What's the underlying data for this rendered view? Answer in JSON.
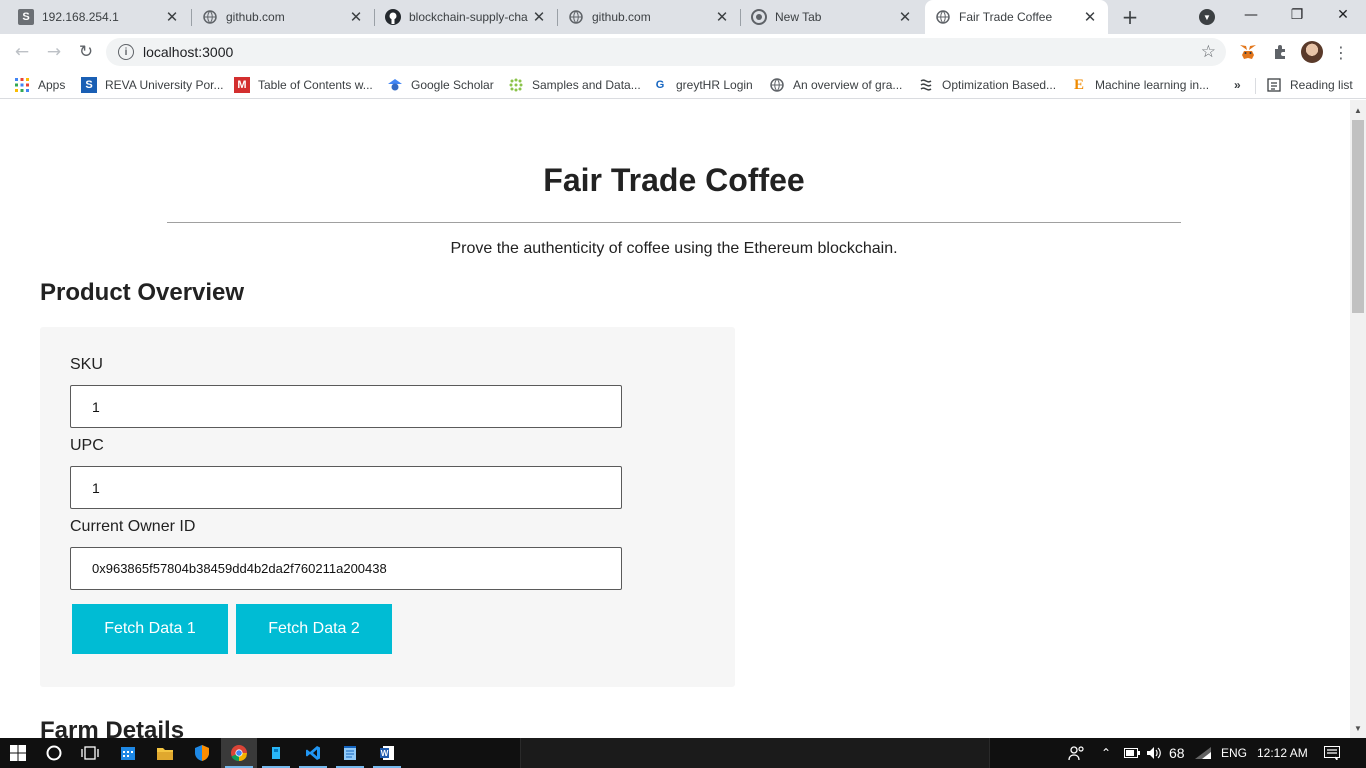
{
  "browser": {
    "tabs": [
      {
        "title": "192.168.254.1",
        "icon": "letter-s-icon"
      },
      {
        "title": "github.com",
        "icon": "globe-icon"
      },
      {
        "title": "blockchain-supply-cha",
        "icon": "github-icon"
      },
      {
        "title": "github.com",
        "icon": "globe-icon"
      },
      {
        "title": "New Tab",
        "icon": "chrome-icon"
      },
      {
        "title": "Fair Trade Coffee",
        "icon": "globe-icon",
        "active": true
      }
    ],
    "url": "localhost:3000",
    "bookmarks": [
      {
        "label": "Apps",
        "icon": "apps-grid-icon"
      },
      {
        "label": "REVA University Por...",
        "icon": "letter-s-icon"
      },
      {
        "label": "Table of Contents w...",
        "icon": "letter-m-icon"
      },
      {
        "label": "Google Scholar",
        "icon": "scholar-icon"
      },
      {
        "label": "Samples and Data...",
        "icon": "dots-icon"
      },
      {
        "label": "greytHR Login",
        "icon": "greythr-icon"
      },
      {
        "label": "An overview of gra...",
        "icon": "globe-icon"
      },
      {
        "label": "Optimization Based...",
        "icon": "wave-icon"
      },
      {
        "label": "Machine learning in...",
        "icon": "letter-e-icon"
      }
    ],
    "bookmarks_overflow": "»",
    "reading_list": "Reading list"
  },
  "page": {
    "title": "Fair Trade Coffee",
    "subtitle": "Prove the authenticity of coffee using the Ethereum blockchain.",
    "product_overview": {
      "heading": "Product Overview",
      "sku_label": "SKU",
      "sku_value": "1",
      "upc_label": "UPC",
      "upc_value": "1",
      "owner_label": "Current Owner ID",
      "owner_value": "0x963865f57804b38459dd4b2da2f760211a200438",
      "fetch1_label": "Fetch Data 1",
      "fetch2_label": "Fetch Data 2"
    },
    "farm_details": {
      "heading": "Farm Details"
    }
  },
  "taskbar": {
    "apps": [
      "task-view",
      "calendar",
      "file-explorer",
      "security",
      "chrome",
      "blue-app",
      "vscode",
      "notepad",
      "word"
    ],
    "battery": "68",
    "language": "ENG",
    "time": "12:12 AM"
  }
}
